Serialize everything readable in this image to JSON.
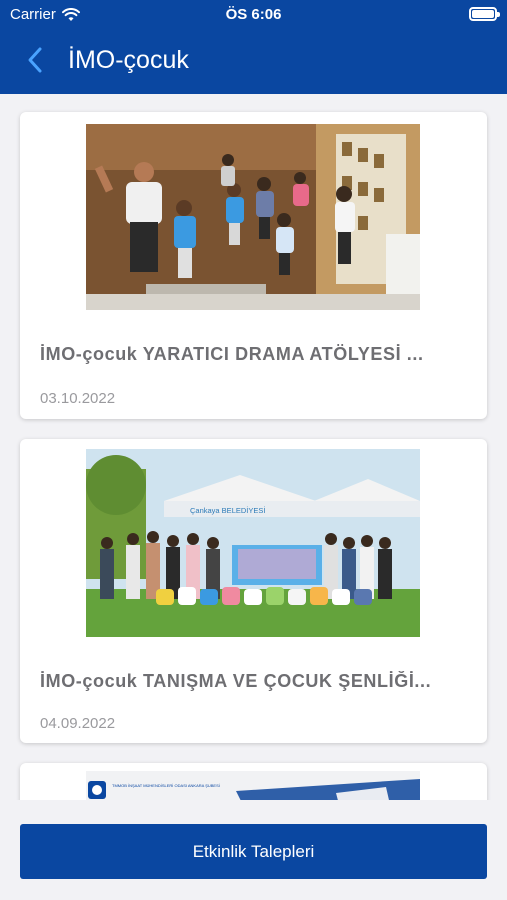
{
  "status_bar": {
    "carrier": "Carrier",
    "time": "ÖS 6:06",
    "battery_level": 1.0
  },
  "nav": {
    "title": "İMO-çocuk",
    "back_icon": "chevron-left-icon"
  },
  "events": [
    {
      "title": "İMO-çocuk YARATICI DRAMA ATÖLYESİ ...",
      "date": "03.10.2022"
    },
    {
      "title": "İMO-çocuk TANIŞMA VE ÇOCUK ŞENLİĞİ...",
      "date": "04.09.2022"
    },
    {
      "title": "",
      "date": ""
    }
  ],
  "image_texts": {
    "tent_banner": "Çankaya BELEDİYESİ",
    "flyer_header": "TMMOB İNŞAAT MÜHENDİSLERİ ODASI ANKARA ŞUBESİ"
  },
  "action": {
    "label": "Etkinlik Talepleri"
  },
  "colors": {
    "primary": "#0a47a1",
    "background": "#f2f2f5"
  }
}
